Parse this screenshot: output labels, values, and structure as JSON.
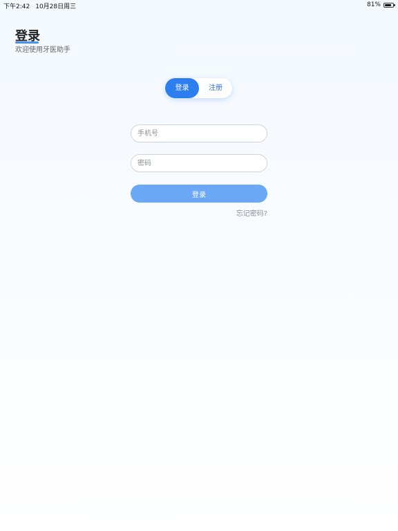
{
  "status_bar": {
    "time": "下午2:42",
    "date": "10月28日周三",
    "battery_percent": "81%",
    "battery_level": 0.81
  },
  "header": {
    "title": "登录",
    "subtitle": "欢迎使用牙医助手"
  },
  "tabs": {
    "login_label": "登录",
    "register_label": "注册",
    "active": "login"
  },
  "form": {
    "phone_placeholder": "手机号",
    "phone_value": "",
    "password_placeholder": "密码",
    "password_value": "",
    "submit_label": "登录",
    "forgot_label": "忘记密码?"
  },
  "colors": {
    "accent": "#2d7ff0",
    "submit_disabled": "#6aa8f6",
    "muted_text": "#8a8f96"
  }
}
